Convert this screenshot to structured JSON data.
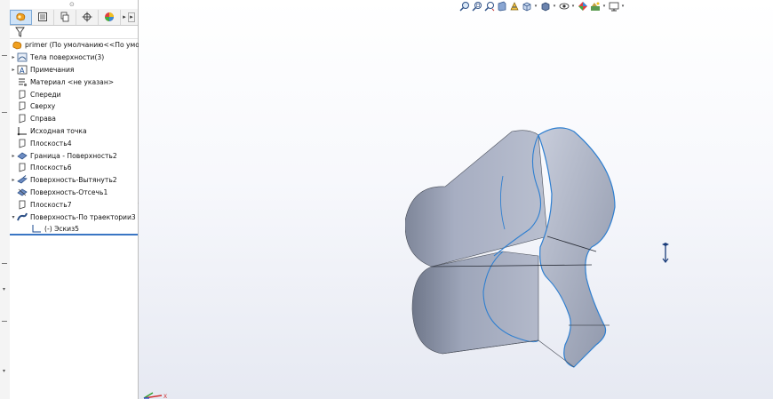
{
  "window": {
    "title": "primer"
  },
  "feature_manager": {
    "tabs": [
      {
        "icon": "feature-manager-icon",
        "active": true
      },
      {
        "icon": "property-manager-icon",
        "active": false
      },
      {
        "icon": "configuration-manager-icon",
        "active": false
      },
      {
        "icon": "dimxpert-manager-icon",
        "active": false
      },
      {
        "icon": "display-manager-icon",
        "active": false
      }
    ],
    "filter_icon": "filter-icon",
    "root": {
      "label": "primer  (По умолчанию<<По умолч"
    },
    "items": [
      {
        "label": "Тела поверхности(3)",
        "icon": "surface-bodies-icon",
        "expandable": true
      },
      {
        "label": "Примечания",
        "icon": "annotations-icon",
        "expandable": true
      },
      {
        "label": "Материал <не указан>",
        "icon": "material-icon",
        "expandable": false
      },
      {
        "label": "Спереди",
        "icon": "plane-icon",
        "expandable": false
      },
      {
        "label": "Сверху",
        "icon": "plane-icon",
        "expandable": false
      },
      {
        "label": "Справа",
        "icon": "plane-icon",
        "expandable": false
      },
      {
        "label": "Исходная точка",
        "icon": "origin-icon",
        "expandable": false
      },
      {
        "label": "Плоскость4",
        "icon": "plane-icon",
        "expandable": false
      },
      {
        "label": "Граница - Поверхность2",
        "icon": "boundary-surface-icon",
        "expandable": true
      },
      {
        "label": "Плоскость6",
        "icon": "plane-icon",
        "expandable": false
      },
      {
        "label": "Поверхность-Вытянуть2",
        "icon": "extruded-surface-icon",
        "expandable": true
      },
      {
        "label": "Поверхность-Отсечь1",
        "icon": "trimmed-surface-icon",
        "expandable": false
      },
      {
        "label": "Плоскость7",
        "icon": "plane-icon",
        "expandable": false
      },
      {
        "label": "Поверхность-По траектории3",
        "icon": "swept-surface-icon",
        "expandable": true,
        "expanded": true
      },
      {
        "label": "(-) Эскиз5",
        "icon": "sketch-icon",
        "expandable": false,
        "child": true
      }
    ]
  },
  "heads_up_toolbar": [
    "zoom-to-fit-icon",
    "zoom-to-area-icon",
    "previous-view-icon",
    "section-view-icon",
    "dynamic-annotation-icon",
    "view-orientation-icon",
    "display-style-icon",
    "hide-show-items-icon",
    "edit-appearance-icon",
    "apply-scene-icon",
    "view-settings-icon"
  ],
  "triad": {
    "x_label": "X"
  },
  "colors": {
    "model_fill": "#a9b0c4",
    "model_edge": "#2f7fd0",
    "tab_active": "#cfe3f7",
    "selection_line": "#3a76c4"
  }
}
